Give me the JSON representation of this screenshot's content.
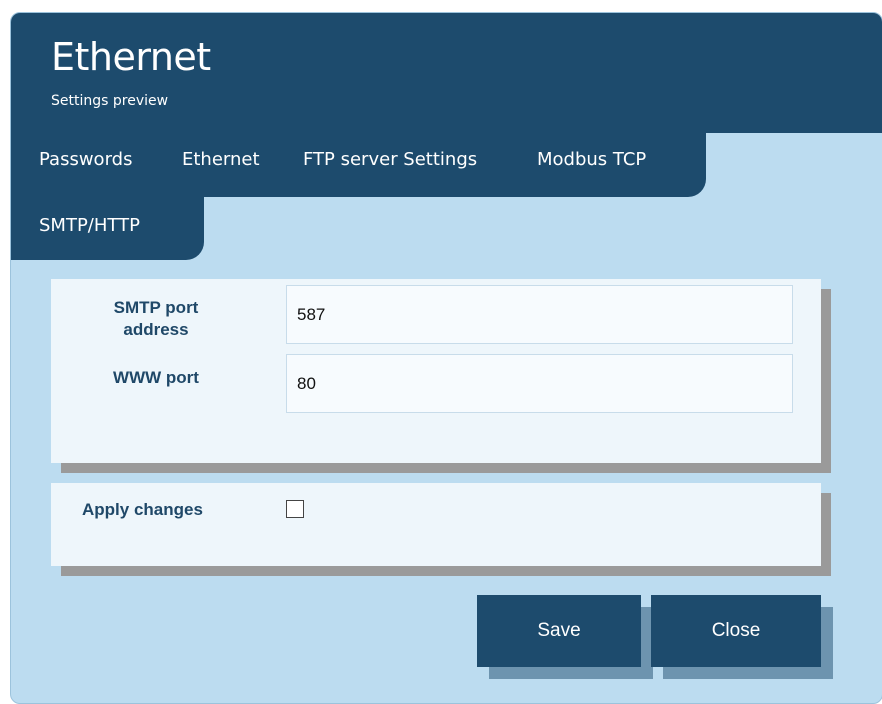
{
  "window": {
    "title": "Ethernet",
    "subtitle": "Settings preview"
  },
  "tabs": [
    {
      "label": "Passwords"
    },
    {
      "label": "Ethernet"
    },
    {
      "label": "FTP server Settings"
    },
    {
      "label": "Modbus TCP"
    },
    {
      "label": "SMTP/HTTP"
    }
  ],
  "form": {
    "smtp_port": {
      "label_line1": "SMTP port",
      "label_line2": "address",
      "value": "587"
    },
    "www_port": {
      "label": "WWW port",
      "value": "80"
    }
  },
  "apply": {
    "label": "Apply changes",
    "checked": false
  },
  "buttons": {
    "save": "Save",
    "close": "Close"
  },
  "colors": {
    "header": "#1d4b6d",
    "background": "#bcdcf0",
    "panel": "#eef6fb",
    "label": "#1f4868"
  }
}
